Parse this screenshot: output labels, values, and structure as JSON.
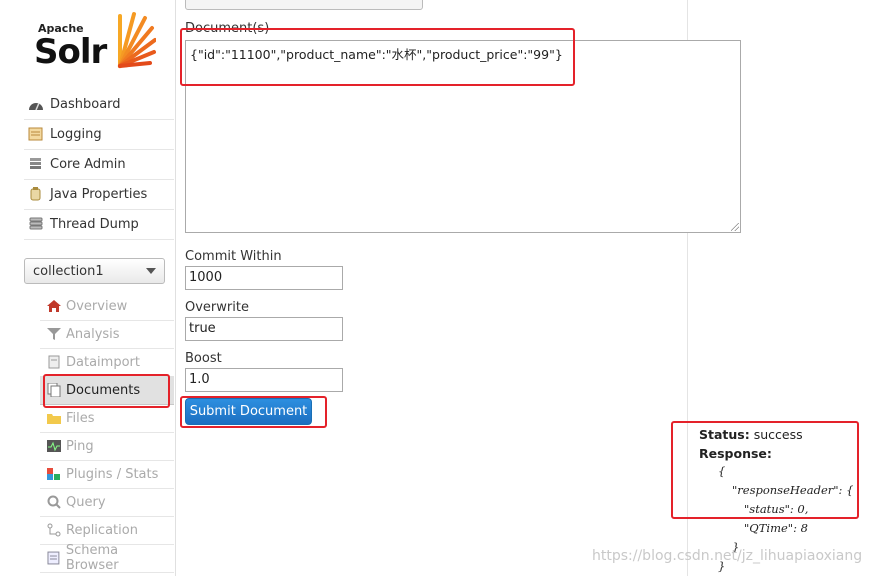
{
  "logo": {
    "apache": "Apache",
    "solr": "Solr"
  },
  "nav": [
    {
      "label": "Dashboard",
      "icon": "dashboard-icon"
    },
    {
      "label": "Logging",
      "icon": "logging-icon"
    },
    {
      "label": "Core Admin",
      "icon": "core-admin-icon"
    },
    {
      "label": "Java Properties",
      "icon": "java-icon"
    },
    {
      "label": "Thread Dump",
      "icon": "thread-dump-icon"
    }
  ],
  "core_selector": {
    "value": "collection1"
  },
  "core_menu": [
    {
      "label": "Overview",
      "icon": "home-icon",
      "active": false
    },
    {
      "label": "Analysis",
      "icon": "filter-icon",
      "active": false
    },
    {
      "label": "Dataimport",
      "icon": "dataimport-icon",
      "active": false
    },
    {
      "label": "Documents",
      "icon": "documents-icon",
      "active": true
    },
    {
      "label": "Files",
      "icon": "folder-icon",
      "active": false
    },
    {
      "label": "Ping",
      "icon": "ping-icon",
      "active": false
    },
    {
      "label": "Plugins / Stats",
      "icon": "plugins-icon",
      "active": false
    },
    {
      "label": "Query",
      "icon": "search-icon",
      "active": false
    },
    {
      "label": "Replication",
      "icon": "replication-icon",
      "active": false
    },
    {
      "label": "Schema Browser",
      "icon": "schema-icon",
      "active": false
    }
  ],
  "form": {
    "document_type": "JSON",
    "documents_label": "Document(s)",
    "documents_value": "{\"id\":\"11100\",\"product_name\":\"水杯\",\"product_price\":\"99\"}",
    "commit_within_label": "Commit Within",
    "commit_within_value": "1000",
    "overwrite_label": "Overwrite",
    "overwrite_value": "true",
    "boost_label": "Boost",
    "boost_value": "1.0",
    "submit_label": "Submit Document"
  },
  "response": {
    "status_label": "Status:",
    "status_value": "success",
    "response_label": "Response:",
    "lines": [
      "{",
      "\"responseHeader\": {",
      "\"status\": 0,",
      "\"QTime\": 8",
      "}",
      "}"
    ]
  },
  "watermark": "https://blog.csdn.net/jz_lihuapiaoxiang",
  "colors": {
    "highlight": "#e4222a",
    "button": "#1c6fc0"
  }
}
